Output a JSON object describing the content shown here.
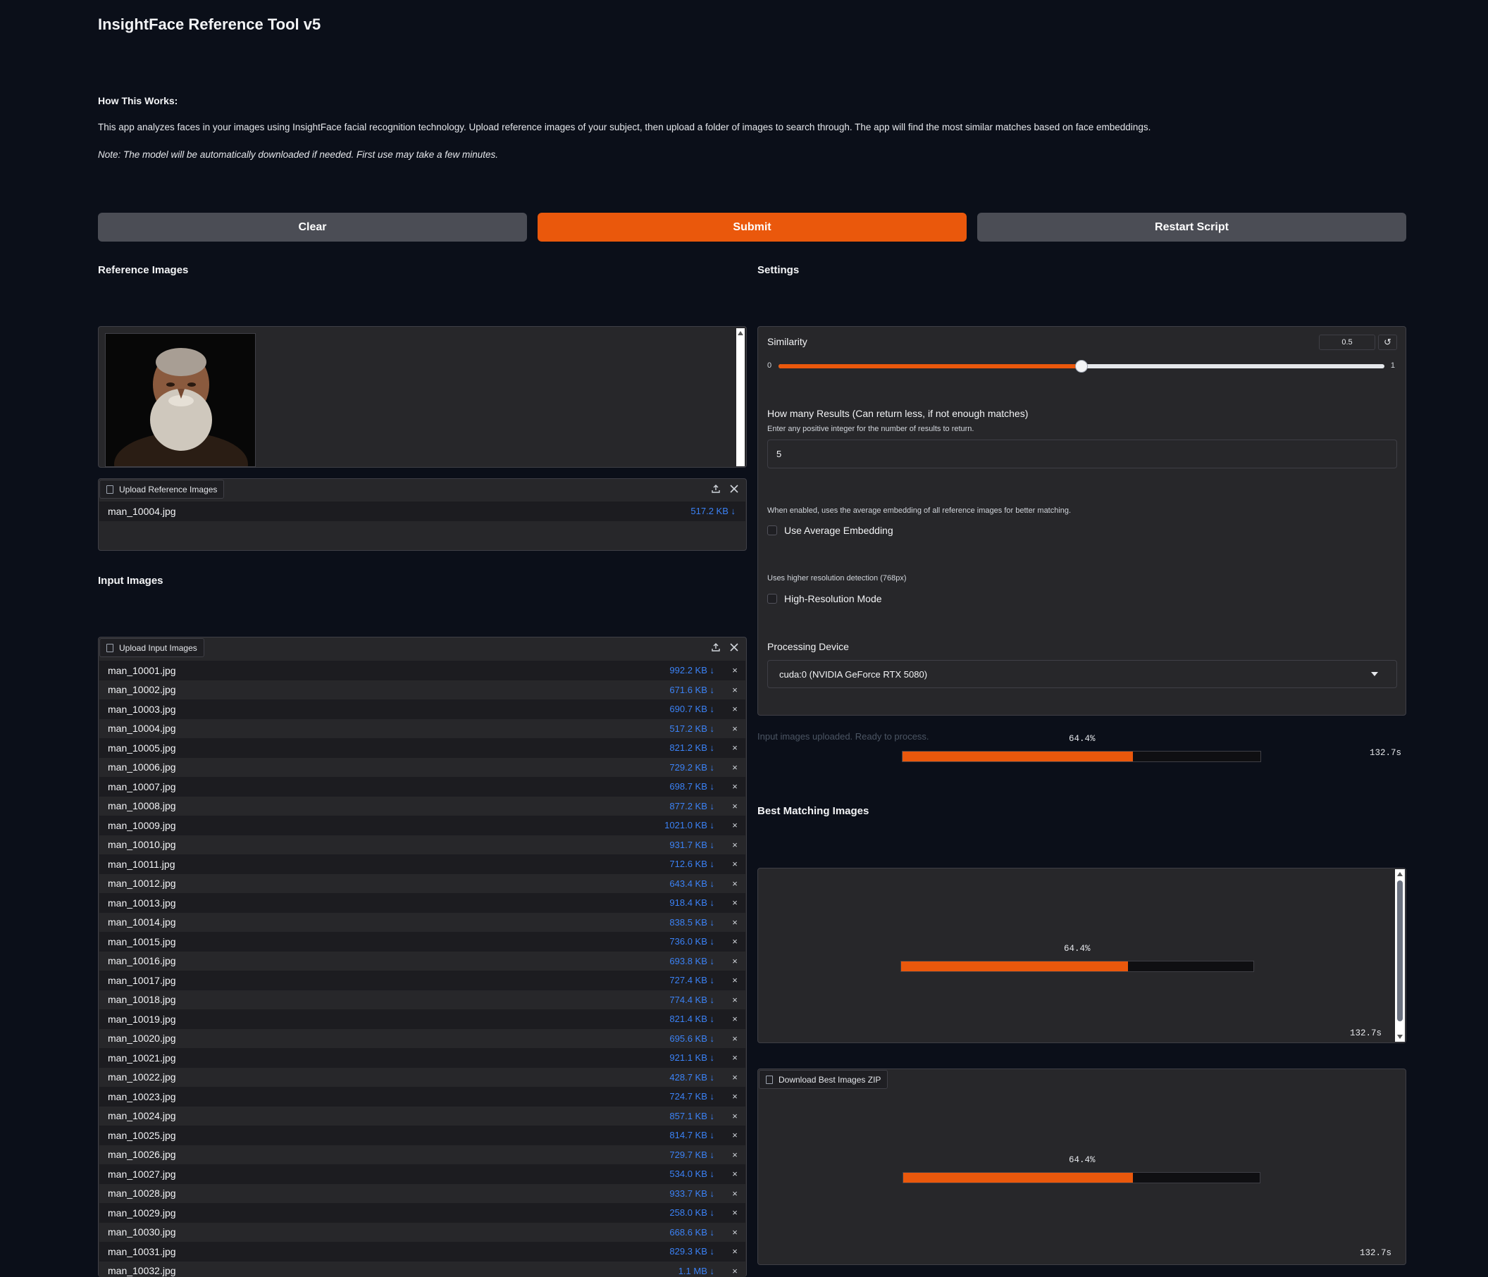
{
  "app": {
    "title": "InsightFace Reference Tool v5",
    "how_heading": "How This Works:",
    "description": "This app analyzes faces in your images using InsightFace facial recognition technology. Upload reference images of your subject, then upload a folder of images to search through. The app will find the most similar matches based on face embeddings.",
    "note": "Note: The model will be automatically downloaded if needed. First use may take a few minutes."
  },
  "actions": {
    "clear": "Clear",
    "submit": "Submit",
    "restart": "Restart Script"
  },
  "colors": {
    "accent": "#ea580c",
    "background": "#0b0f19",
    "panel": "#27272a",
    "link": "#3b82f6"
  },
  "reference": {
    "heading": "Reference Images",
    "upload_label": "Upload Reference Images",
    "files": [
      {
        "name": "man_10004.jpg",
        "size": "517.2 KB ↓"
      }
    ]
  },
  "input": {
    "heading": "Input Images",
    "upload_label": "Upload Input Images",
    "files": [
      {
        "name": "man_10001.jpg",
        "size": "992.2 KB ↓"
      },
      {
        "name": "man_10002.jpg",
        "size": "671.6 KB ↓"
      },
      {
        "name": "man_10003.jpg",
        "size": "690.7 KB ↓"
      },
      {
        "name": "man_10004.jpg",
        "size": "517.2 KB ↓"
      },
      {
        "name": "man_10005.jpg",
        "size": "821.2 KB ↓"
      },
      {
        "name": "man_10006.jpg",
        "size": "729.2 KB ↓"
      },
      {
        "name": "man_10007.jpg",
        "size": "698.7 KB ↓"
      },
      {
        "name": "man_10008.jpg",
        "size": "877.2 KB ↓"
      },
      {
        "name": "man_10009.jpg",
        "size": "1021.0 KB ↓"
      },
      {
        "name": "man_10010.jpg",
        "size": "931.7 KB ↓"
      },
      {
        "name": "man_10011.jpg",
        "size": "712.6 KB ↓"
      },
      {
        "name": "man_10012.jpg",
        "size": "643.4 KB ↓"
      },
      {
        "name": "man_10013.jpg",
        "size": "918.4 KB ↓"
      },
      {
        "name": "man_10014.jpg",
        "size": "838.5 KB ↓"
      },
      {
        "name": "man_10015.jpg",
        "size": "736.0 KB ↓"
      },
      {
        "name": "man_10016.jpg",
        "size": "693.8 KB ↓"
      },
      {
        "name": "man_10017.jpg",
        "size": "727.4 KB ↓"
      },
      {
        "name": "man_10018.jpg",
        "size": "774.4 KB ↓"
      },
      {
        "name": "man_10019.jpg",
        "size": "821.4 KB ↓"
      },
      {
        "name": "man_10020.jpg",
        "size": "695.6 KB ↓"
      },
      {
        "name": "man_10021.jpg",
        "size": "921.1 KB ↓"
      },
      {
        "name": "man_10022.jpg",
        "size": "428.7 KB ↓"
      },
      {
        "name": "man_10023.jpg",
        "size": "724.7 KB ↓"
      },
      {
        "name": "man_10024.jpg",
        "size": "857.1 KB ↓"
      },
      {
        "name": "man_10025.jpg",
        "size": "814.7 KB ↓"
      },
      {
        "name": "man_10026.jpg",
        "size": "729.7 KB ↓"
      },
      {
        "name": "man_10027.jpg",
        "size": "534.0 KB ↓"
      },
      {
        "name": "man_10028.jpg",
        "size": "933.7 KB ↓"
      },
      {
        "name": "man_10029.jpg",
        "size": "258.0 KB ↓"
      },
      {
        "name": "man_10030.jpg",
        "size": "668.6 KB ↓"
      },
      {
        "name": "man_10031.jpg",
        "size": "829.3 KB ↓"
      },
      {
        "name": "man_10032.jpg",
        "size": "1.1 MB ↓"
      }
    ]
  },
  "settings": {
    "heading": "Settings",
    "similarity": {
      "label": "Similarity",
      "value": "0.5",
      "min": "0",
      "max": "1",
      "fraction": 0.5
    },
    "results": {
      "label": "How many Results (Can return less, if not enough matches)",
      "info": "Enter any positive integer for the number of results to return.",
      "value": "5"
    },
    "average": {
      "info": "When enabled, uses the average embedding of all reference images for better matching.",
      "label": "Use Average Embedding",
      "checked": false
    },
    "highres": {
      "info": "Uses higher resolution detection (768px)",
      "label": "High-Resolution Mode",
      "checked": false
    },
    "device": {
      "label": "Processing Device",
      "value": "cuda:0 (NVIDIA GeForce RTX 5080)"
    }
  },
  "status": {
    "text": "Input images uploaded. Ready to process.",
    "percent_label": "64.4%",
    "fraction": 0.644,
    "elapsed": "132.7s"
  },
  "best": {
    "heading": "Best Matching Images",
    "percent_label": "64.4%",
    "elapsed": "132.7s"
  },
  "download": {
    "label": "Download Best Images ZIP",
    "percent_label": "64.4%",
    "elapsed": "132.7s"
  },
  "icons": {
    "file": "file-icon",
    "upload": "upload-icon",
    "close": "close-icon",
    "reset": "reset-icon",
    "dropdown": "chevron-down-icon"
  }
}
